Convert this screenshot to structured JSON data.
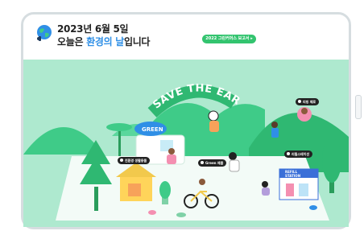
{
  "header": {
    "date": "2023년 6월 5일",
    "message_pre": "오늘은 ",
    "message_highlight": "환경의 날",
    "message_post": "입니다"
  },
  "report_button": {
    "label": "2022 그린커머스 보고서 ▸"
  },
  "illustration": {
    "banner": "SAVE THE EARTH",
    "green_sign": "GREEN",
    "refill_sign_line1": "REFILL",
    "refill_sign_line2": "STATION",
    "pins": {
      "top_right": "리빙 제로",
      "left_house": "친환경 생활용품",
      "center": "Green 제품",
      "right": "리필스테이션"
    }
  },
  "colors": {
    "ground": "#aee9cf",
    "mountain": "#3fcb88",
    "banner": "#2fb872",
    "highlight_text": "#2f8fe6",
    "report_pill": "#33c46f"
  }
}
